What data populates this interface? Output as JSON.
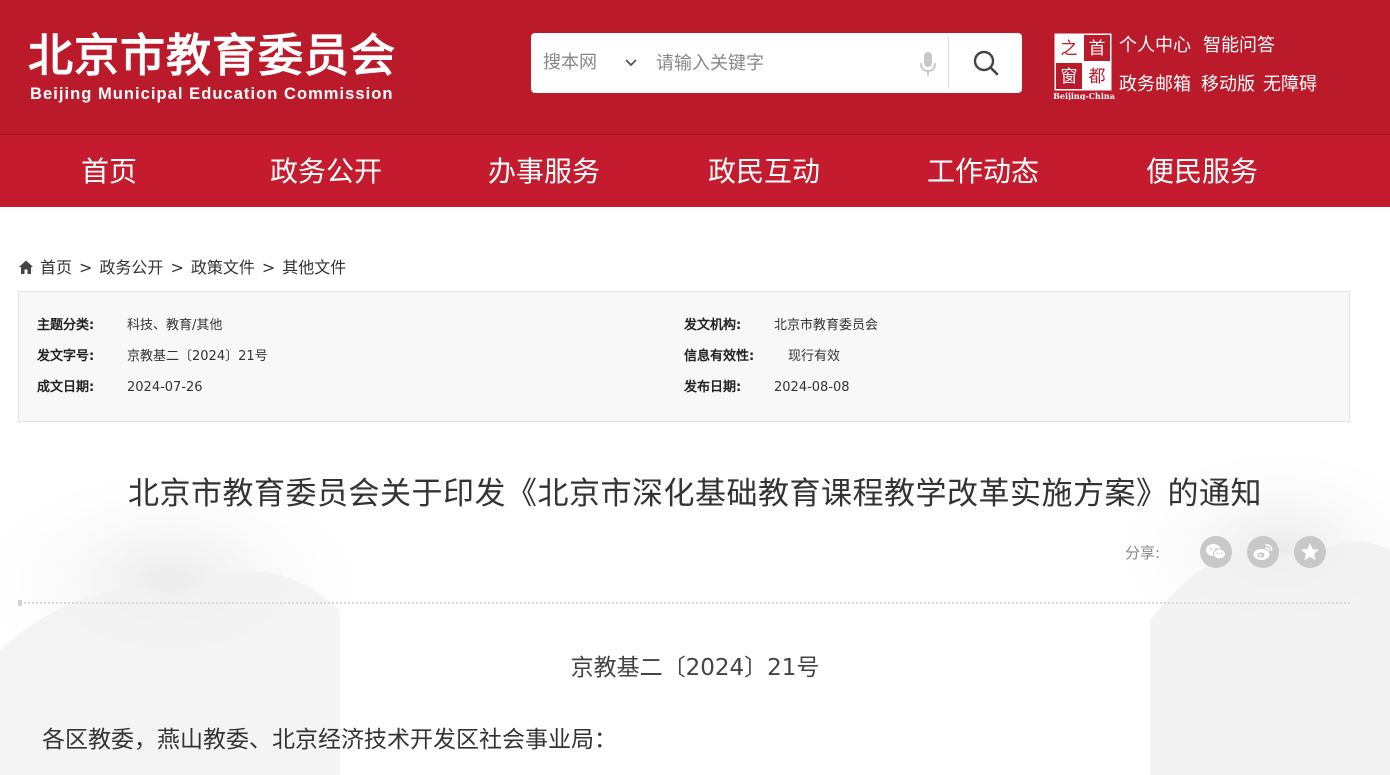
{
  "header": {
    "logo_cn": "北京市教育委员会",
    "logo_en": "Beijing Municipal Education Commission",
    "search_scope": "搜本网",
    "search_placeholder": "请输入关键字",
    "capital_logo_text": "Beijing-China",
    "capital_logo_chars": [
      "首",
      "都",
      "之",
      "窗"
    ],
    "links_row1": [
      "个人中心",
      "智能问答"
    ],
    "links_row2": [
      "政务邮箱",
      "移动版",
      "无障碍"
    ]
  },
  "nav": {
    "items": [
      "首页",
      "政务公开",
      "办事服务",
      "政民互动",
      "工作动态",
      "便民服务"
    ]
  },
  "breadcrumb": {
    "items": [
      "首页",
      "政务公开",
      "政策文件",
      "其他文件"
    ],
    "separator": ">"
  },
  "meta": {
    "topic_label": "主题分类:",
    "topic_value": "科技、教育/其他",
    "issuer_label": "发文机构:",
    "issuer_value": "北京市教育委员会",
    "docno_label": "发文字号:",
    "docno_value": "京教基二〔2024〕21号",
    "validity_label": "信息有效性:",
    "validity_value": "现行有效",
    "written_label": "成文日期:",
    "written_value": "2024-07-26",
    "published_label": "发布日期:",
    "published_value": "2024-08-08"
  },
  "document": {
    "title": "北京市教育委员会关于印发《北京市深化基础教育课程教学改革实施方案》的通知",
    "share_label": "分享:",
    "share_icons": [
      "wechat-icon",
      "weibo-icon",
      "favorite-icon"
    ],
    "number": "京教基二〔2024〕21号",
    "salutation": "各区教委，燕山教委、北京经济技术开发区社会事业局："
  },
  "colors": {
    "header_red": "#bb1a2b",
    "nav_red": "#c41b2f",
    "share_gray": "#c8c8c8"
  }
}
